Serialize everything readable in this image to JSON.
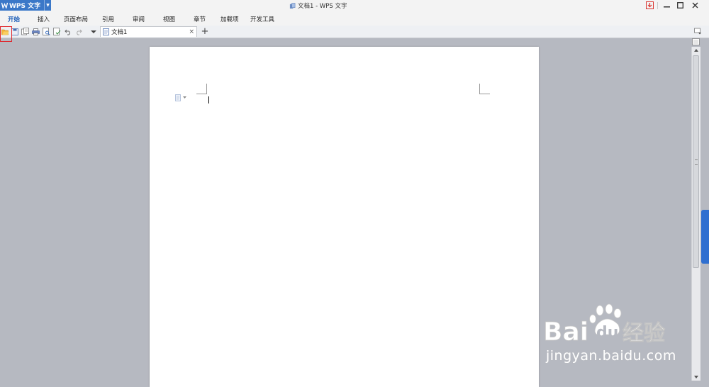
{
  "app": {
    "name": "WPS 文字",
    "window_title": "文档1 - WPS 文字"
  },
  "menu": {
    "items": [
      {
        "label": "开始",
        "active": true
      },
      {
        "label": "插入"
      },
      {
        "label": "页面布局"
      },
      {
        "label": "引用"
      },
      {
        "label": "审阅"
      },
      {
        "label": "视图"
      },
      {
        "label": "章节"
      },
      {
        "label": "加载项"
      },
      {
        "label": "开发工具"
      }
    ]
  },
  "toolbar": {
    "tools": [
      "open-folder-icon",
      "save-icon",
      "save-as-icon",
      "print-icon",
      "print-preview-icon",
      "spell-check-icon",
      "undo-icon",
      "redo-icon",
      "dropdown-icon"
    ]
  },
  "tabs": [
    {
      "label": "文档1"
    }
  ],
  "highlight": {
    "target": "open-folder-icon",
    "color": "#e0262b"
  },
  "colors": {
    "app_button": "#3b78c8",
    "active_menu": "#1f5fb8",
    "workspace": "#b6b9c1",
    "side_handle": "#2f6fd0"
  },
  "watermark": {
    "brand_latin": "Bai",
    "brand_du": "du",
    "brand_cn": "经验",
    "url": "jingyan.baidu.com"
  }
}
